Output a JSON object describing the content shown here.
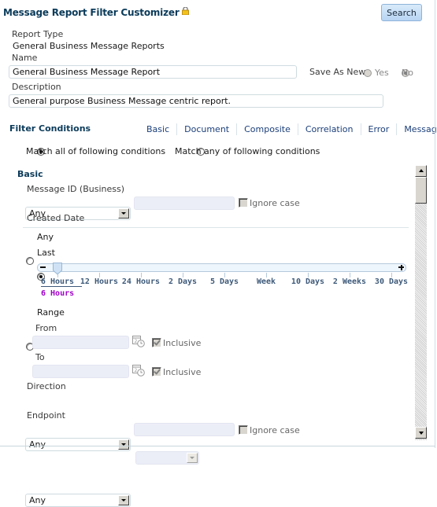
{
  "header": {
    "title": "Message Report Filter Customizer",
    "lock_icon": "lock-icon",
    "search_label": "Search"
  },
  "report": {
    "type_label": "Report Type",
    "type_value": "General Business Message Reports",
    "name_label": "Name",
    "name_value": "General Business Message Report",
    "save_as_new_label": "Save As New",
    "save_as_new_options": [
      {
        "label": "Yes",
        "checked": false
      },
      {
        "label": "No",
        "checked": true
      }
    ],
    "description_label": "Description",
    "description_value": "General purpose Business Message centric report."
  },
  "filter": {
    "title": "Filter Conditions",
    "tabs": [
      "Basic",
      "Document",
      "Composite",
      "Correlation",
      "Error",
      "Message"
    ],
    "match_all_label": "Match all of following conditions",
    "match_any_label": "Match any of following conditions",
    "match_selected": "all"
  },
  "basic": {
    "section_title": "Basic",
    "message_id_label": "Message ID (Business)",
    "message_id_operator": "Any",
    "message_id_value": "",
    "ignore_case_label": "Ignore case",
    "created_date_label": "Created Date",
    "date_any_label": "Any",
    "date_last_label": "Last",
    "date_selected": "last",
    "slider": {
      "stops": [
        "6 Hours",
        "12 Hours",
        "24 Hours",
        "2 Days",
        "5 Days",
        "Week",
        "10 Days",
        "2 Weeks",
        "30 Days"
      ],
      "selected_index": 0,
      "selected_value": "6 Hours",
      "minus_icon": "minus-icon",
      "plus_icon": "plus-icon"
    },
    "date_range_label": "Range",
    "from_label": "From",
    "from_value": "",
    "to_label": "To",
    "to_value": "",
    "inclusive_label": "Inclusive",
    "direction_label": "Direction",
    "direction_value": "Any",
    "direction_secondary_value": "",
    "endpoint_label": "Endpoint",
    "endpoint_operator": "Any",
    "endpoint_value": "",
    "endpoint_ignore_case_label": "Ignore case"
  },
  "colors": {
    "title": "#0b3b5a",
    "tab_link": "#1b3f7a",
    "slider_value": "#a000c8",
    "button_bg": "#c9dff5"
  }
}
